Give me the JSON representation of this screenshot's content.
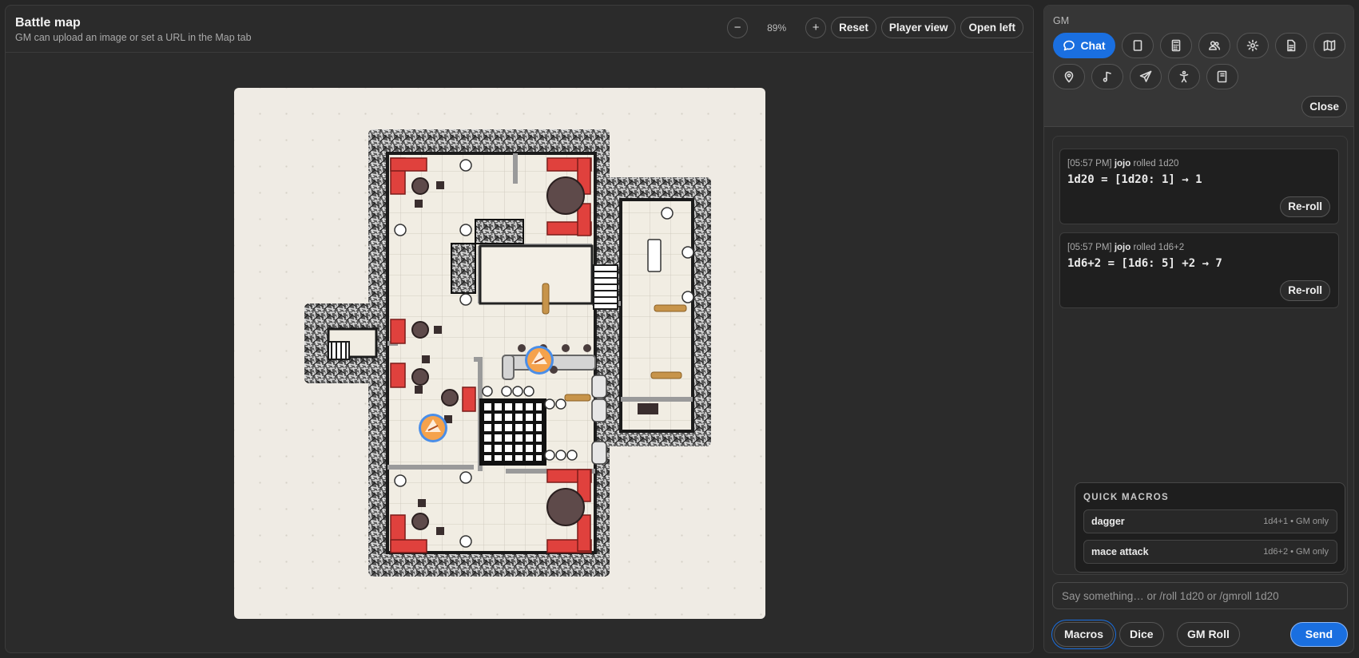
{
  "map": {
    "title": "Battle map",
    "subtitle": "GM can upload an image or set a URL in the Map tab",
    "zoom_out": "−",
    "zoom_level": "89%",
    "zoom_in": "+",
    "reset": "Reset",
    "player_view": "Player view",
    "open_left": "Open left"
  },
  "sidebar": {
    "role_label": "GM",
    "tools_row1": [
      {
        "label": "Chat",
        "icon": "chat-bubble-icon",
        "active": true
      },
      {
        "label": "",
        "icon": "notes-icon"
      },
      {
        "label": "",
        "icon": "calculator-icon"
      },
      {
        "label": "",
        "icon": "users-icon"
      },
      {
        "label": "",
        "icon": "gear-icon"
      },
      {
        "label": "",
        "icon": "document-icon"
      },
      {
        "label": "",
        "icon": "map-icon"
      }
    ],
    "tools_row2": [
      {
        "icon": "map-pin-icon"
      },
      {
        "icon": "music-note-icon"
      },
      {
        "icon": "send-icon"
      },
      {
        "icon": "character-icon"
      },
      {
        "icon": "handbook-icon"
      }
    ],
    "close": "Close"
  },
  "chat": {
    "messages": [
      {
        "time": "[05:57 PM]",
        "user": "jojo",
        "action": "rolled 1d20",
        "result": "1d20 = [1d20: 1] → 1",
        "reroll": "Re-roll"
      },
      {
        "time": "[05:57 PM]",
        "user": "jojo",
        "action": "rolled 1d6+2",
        "result": "1d6+2 = [1d6: 5] +2 → 7",
        "reroll": "Re-roll"
      }
    ],
    "macros": {
      "title": "QUICK MACROS",
      "items": [
        {
          "name": "dagger",
          "info": "1d4+1 • GM only"
        },
        {
          "name": "mace attack",
          "info": "1d6+2 • GM only"
        }
      ]
    },
    "input_placeholder": "Say something… or /roll 1d20 or /gmroll 1d20",
    "buttons": {
      "macros": "Macros",
      "dice": "Dice",
      "gm_roll": "GM Roll",
      "send": "Send"
    }
  },
  "colors": {
    "accent": "#1a6fe0",
    "token_ring": "#4a8ee8",
    "couch_red": "#e0413d"
  }
}
